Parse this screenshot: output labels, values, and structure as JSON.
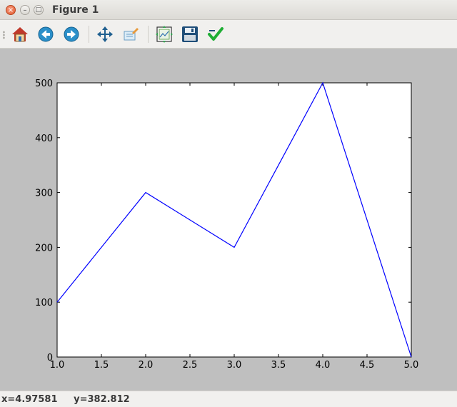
{
  "window": {
    "title": "Figure 1",
    "close_glyph": "×",
    "minimize_glyph": "–",
    "maximize_glyph": "□"
  },
  "toolbar": {
    "items": [
      {
        "name": "home",
        "icon": "home-icon"
      },
      {
        "name": "back",
        "icon": "back-arrow-icon"
      },
      {
        "name": "forward",
        "icon": "forward-arrow-icon"
      },
      {
        "name": "pan",
        "icon": "pan-move-icon"
      },
      {
        "name": "zoom",
        "icon": "zoom-rect-icon"
      },
      {
        "name": "subplots",
        "icon": "subplots-config-icon"
      },
      {
        "name": "save",
        "icon": "floppy-save-icon"
      },
      {
        "name": "edit",
        "icon": "checkmark-edit-icon"
      }
    ]
  },
  "status": {
    "text": "x=4.97581     y=382.812"
  },
  "colors": {
    "line": "#0000ff",
    "background": "#bfbfbf",
    "axes_face": "#ffffff"
  },
  "chart_data": {
    "type": "line",
    "x": [
      1.0,
      2.0,
      3.0,
      4.0,
      5.0
    ],
    "series": [
      {
        "values": [
          100,
          300,
          200,
          500,
          0
        ]
      }
    ],
    "xlim": [
      1.0,
      5.0
    ],
    "ylim": [
      0,
      500
    ],
    "xticks": [
      1.0,
      1.5,
      2.0,
      2.5,
      3.0,
      3.5,
      4.0,
      4.5,
      5.0
    ],
    "xtick_labels": [
      "1.0",
      "1.5",
      "2.0",
      "2.5",
      "3.0",
      "3.5",
      "4.0",
      "4.5",
      "5.0"
    ],
    "yticks": [
      0,
      100,
      200,
      300,
      400,
      500
    ],
    "ytick_labels": [
      "0",
      "100",
      "200",
      "300",
      "400",
      "500"
    ],
    "title": "",
    "xlabel": "",
    "ylabel": "",
    "grid": false
  }
}
